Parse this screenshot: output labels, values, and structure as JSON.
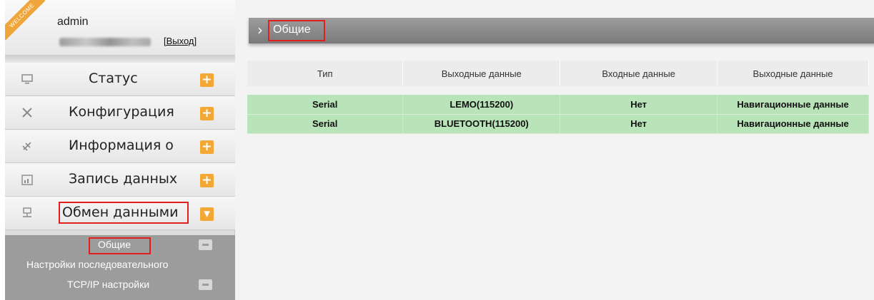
{
  "user": {
    "badge": "WELCOME",
    "name": "admin",
    "logout": "[Выход]"
  },
  "menu": [
    {
      "label": "Статус",
      "icon": "monitor-icon",
      "toggle": "+"
    },
    {
      "label": "Конфигурация",
      "icon": "tools-icon",
      "toggle": "+"
    },
    {
      "label": "Информация о",
      "icon": "satellite-icon",
      "toggle": "+"
    },
    {
      "label": "Запись данных",
      "icon": "calendar-icon",
      "toggle": "+"
    },
    {
      "label": "Обмен данными",
      "icon": "network-icon",
      "toggle": "▾",
      "expanded": true
    }
  ],
  "submenu": [
    {
      "label": "Общие",
      "selected": true
    },
    {
      "label": "Настройки последовательного"
    },
    {
      "label": "TCP/IP настройки"
    }
  ],
  "main": {
    "title": "Общие",
    "table": {
      "headers": [
        "Тип",
        "Выходные данные",
        "Входные данные",
        "Выходные данные"
      ],
      "rows": [
        [
          "Serial",
          "LEMO(115200)",
          "Нет",
          "Навигационные данные"
        ],
        [
          "Serial",
          "BLUETOOTH(115200)",
          "Нет",
          "Навигационные данные"
        ]
      ]
    }
  },
  "colors": {
    "accent_orange": "#f3a734",
    "highlight_red": "#e0201c",
    "row_green": "#b9e4b9",
    "header_gray": "#8a8a8a"
  }
}
